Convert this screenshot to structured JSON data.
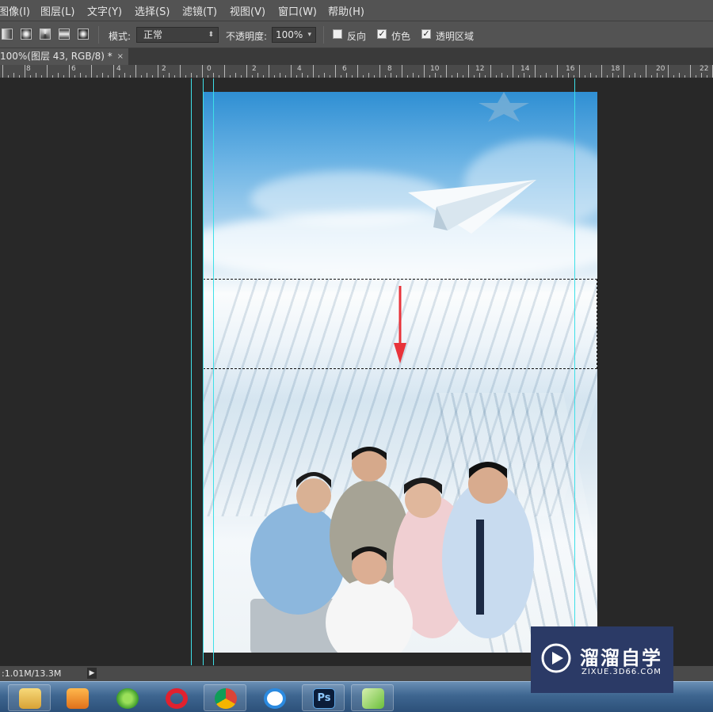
{
  "menu": [
    "图像(I)",
    "图层(L)",
    "文字(Y)",
    "选择(S)",
    "滤镜(T)",
    "视图(V)",
    "窗口(W)",
    "帮助(H)"
  ],
  "options": {
    "mode_label": "模式:",
    "mode_value": "正常",
    "opacity_label": "不透明度:",
    "opacity_value": "100%",
    "reverse_label": "反向",
    "reverse_checked": false,
    "dither_label": "仿色",
    "dither_checked": true,
    "transparency_label": "透明区域",
    "transparency_checked": true
  },
  "document_tab": {
    "title": "100%(图层 43, RGB/8) *",
    "close": "×"
  },
  "ruler_labels": [
    "8",
    "6",
    "4",
    "2",
    "0",
    "2",
    "4",
    "6",
    "8",
    "10",
    "12",
    "14",
    "16",
    "18",
    "20",
    "22"
  ],
  "status": {
    "doc_size": ":1.01M/13.3M",
    "arrow": "▶"
  },
  "taskbar_apps": [
    "file-explorer",
    "media-player",
    "browser-360",
    "opera",
    "chrome",
    "baidu-netdisk",
    "photoshop",
    "app-green"
  ],
  "photoshop_label": "Ps",
  "watermark": {
    "title": "溜溜自学",
    "subtitle": "ZIXUE.3D66.COM"
  },
  "colors": {
    "guide": "#3de0e8",
    "arrow": "#e8333a",
    "panel": "#535353",
    "workspace": "#282828"
  }
}
